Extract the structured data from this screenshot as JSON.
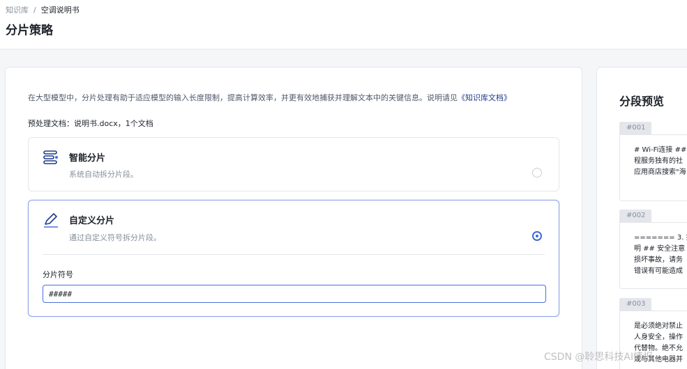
{
  "breadcrumb": {
    "root": "知识库",
    "separator": "/",
    "current": "空调说明书"
  },
  "page_title": "分片策略",
  "main": {
    "description": "在大型模型中，分片处理有助于适应模型的输入长度限制，提高计算效率，并更有效地捕获并理解文本中的关键信息。说明请见",
    "description_link": "《知识库文档》",
    "doc_line": "预处理文档：说明书.docx，1个文档",
    "options": [
      {
        "title": "智能分片",
        "subtitle": "系统自动拆分片段。",
        "selected": false,
        "icon": "list-lines-icon"
      },
      {
        "title": "自定义分片",
        "subtitle": "通过自定义符号拆分片段。",
        "selected": true,
        "icon": "pen-icon"
      }
    ],
    "separator_label": "分片符号",
    "separator_value": "#####"
  },
  "preview": {
    "title": "分段预览",
    "segments": [
      {
        "tag": "#001",
        "lines": [
          "# Wi-Fi连接 ##",
          "程服务独有的社",
          "应用商店搜索\"海"
        ]
      },
      {
        "tag": "#002",
        "lines": [
          "======= 3. 搜",
          "明 ## 安全注意",
          "损坏事故，请务",
          "错误有可能造成"
        ]
      },
      {
        "tag": "#003",
        "lines": [
          "是必须绝对禁止",
          "人身安全，操作",
          "代替物。绝不允",
          "或与其他电器并"
        ]
      }
    ]
  },
  "watermark": "CSDN @聆思科技AI情报",
  "colors": {
    "accent": "#3b6ad8",
    "link": "#1e3a8a",
    "border": "#e5e6eb"
  }
}
